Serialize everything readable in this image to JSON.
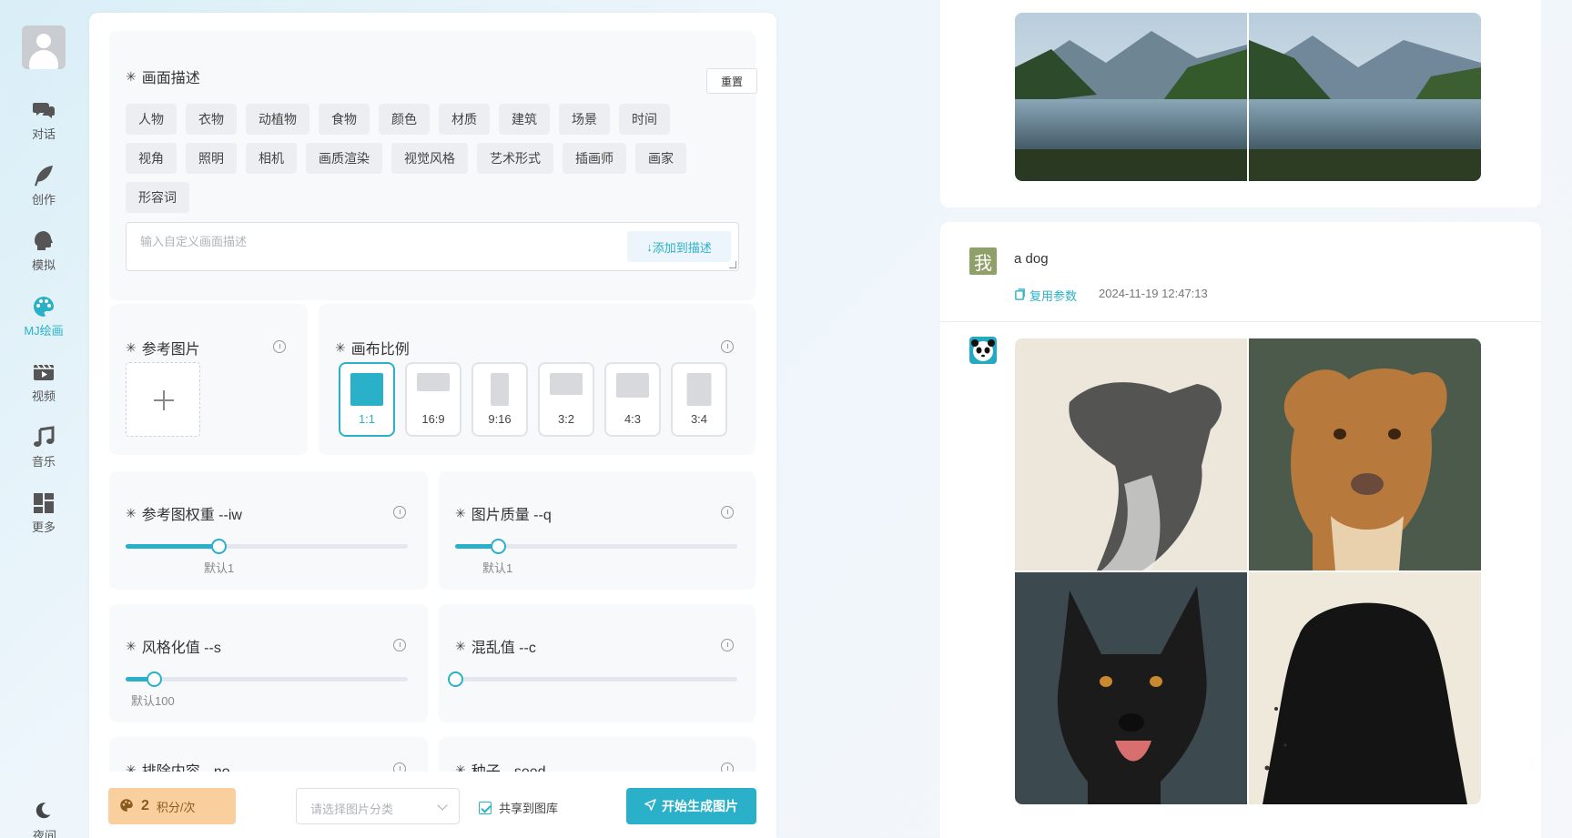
{
  "sidebar": {
    "items": [
      {
        "label": "对话",
        "icon": "chat-icon"
      },
      {
        "label": "创作",
        "icon": "feather-icon"
      },
      {
        "label": "模拟",
        "icon": "head-icon"
      },
      {
        "label": "MJ绘画",
        "icon": "palette-icon",
        "active": true
      },
      {
        "label": "视频",
        "icon": "video-icon"
      },
      {
        "label": "音乐",
        "icon": "music-icon"
      },
      {
        "label": "更多",
        "icon": "grid-icon"
      }
    ],
    "night_label": "夜间"
  },
  "description": {
    "title": "画面描述",
    "reset_label": "重置",
    "tags_row1": [
      "人物",
      "衣物",
      "动植物",
      "食物",
      "颜色",
      "材质",
      "建筑",
      "场景",
      "时间"
    ],
    "tags_row2": [
      "视角",
      "照明",
      "相机",
      "画质渲染",
      "视觉风格",
      "艺术形式",
      "插画师",
      "画家"
    ],
    "tags_row3": [
      "形容词"
    ],
    "input_placeholder": "输入自定义画面描述",
    "add_label": "添加到描述"
  },
  "reference": {
    "title": "参考图片"
  },
  "canvas_ratio": {
    "title": "画布比例",
    "options": [
      "1:1",
      "16:9",
      "9:16",
      "3:2",
      "4:3",
      "3:4"
    ],
    "selected": "1:1"
  },
  "params": {
    "iw": {
      "title": "参考图权重 --iw",
      "note": "默认1",
      "fill": 0.33
    },
    "q": {
      "title": "图片质量 --q",
      "note": "默认1",
      "fill": 0.15
    },
    "s": {
      "title": "风格化值 --s",
      "note": "默认100",
      "fill": 0.1
    },
    "c": {
      "title": "混乱值 --c",
      "note": "",
      "fill": 0.0
    },
    "no": {
      "title": "排除内容 --no"
    },
    "seed": {
      "title": "种子 --seed"
    }
  },
  "bottom": {
    "points_value": "2",
    "points_unit": "积分/次",
    "category_placeholder": "请选择图片分类",
    "share_label": "共享到图库",
    "generate_label": "开始生成图片"
  },
  "feed": {
    "user_badge": "我",
    "prompt": "a dog",
    "reuse_label": "复用参数",
    "timestamp": "2024-11-19 12:47:13"
  },
  "colors": {
    "accent": "#2ab0c8",
    "points_bg": "#f8cf9d"
  }
}
